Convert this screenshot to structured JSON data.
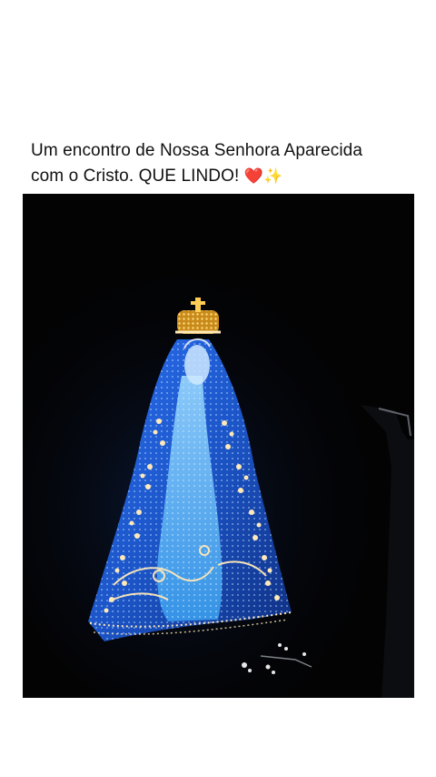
{
  "post": {
    "caption_line1": "Um encontro de Nossa Senhora Aparecida",
    "caption_line2": "com o Cristo. QUE LINDO! ",
    "emoji_heart": "❤️",
    "emoji_sparkles": "✨"
  },
  "image": {
    "subject": "illuminated-statue-of-nossa-senhora-aparecida-at-night",
    "background_color": "#030304",
    "mantle_color": "#1e5fd6",
    "light_color": "#ffe9b8",
    "crown_color": "#e8b042"
  }
}
